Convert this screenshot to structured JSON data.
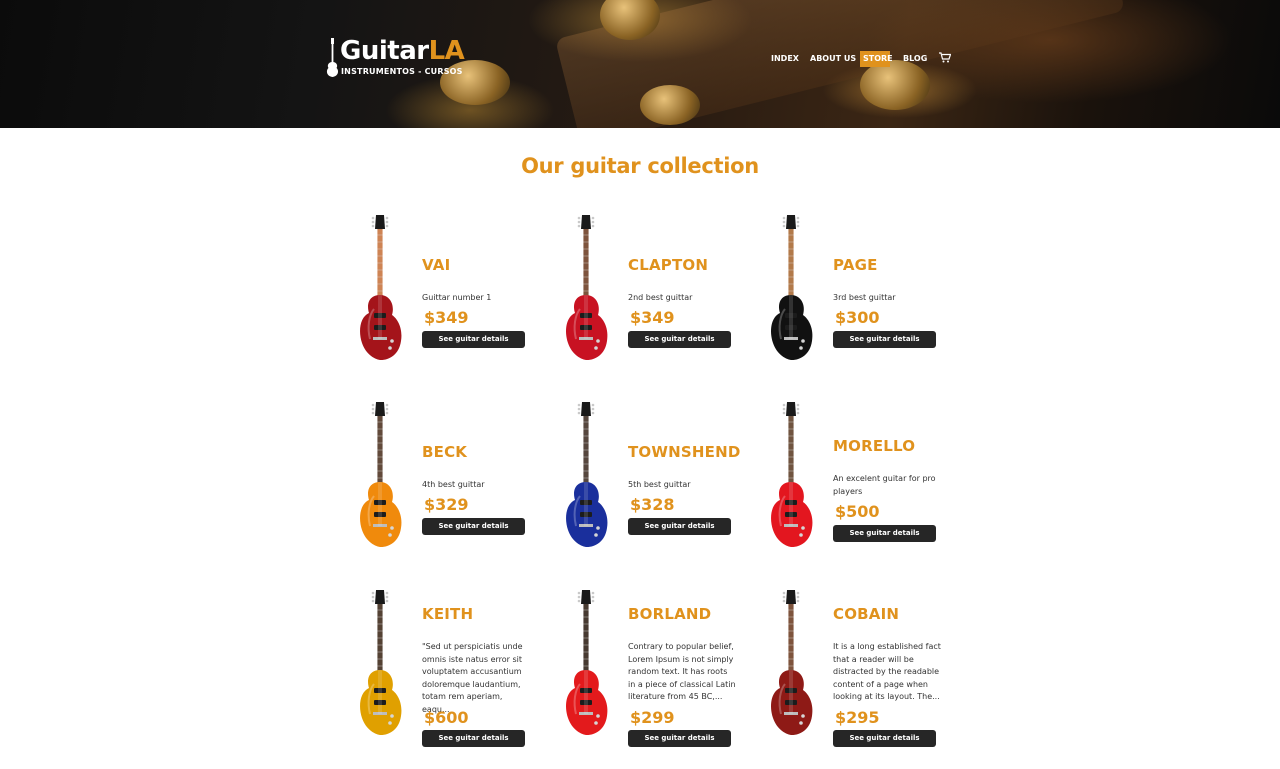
{
  "header": {
    "logo": {
      "word_main": "Guitar",
      "word_accent": "LA",
      "subtitle": "INSTRUMENTOS - CURSOS"
    },
    "nav": [
      {
        "label": "INDEX",
        "active": false
      },
      {
        "label": "ABOUT US",
        "active": false
      },
      {
        "label": "STORE",
        "active": true
      },
      {
        "label": "BLOG",
        "active": false
      }
    ],
    "cart_icon": "shopping-cart-icon"
  },
  "main": {
    "title": "Our guitar collection",
    "button_label": "See guitar details",
    "guitars": [
      {
        "name": "VAI",
        "description": "Guittar number 1",
        "price": "$349",
        "body_color": "#a4141a",
        "neck_color": "#c9713a"
      },
      {
        "name": "CLAPTON",
        "description": "2nd best guittar",
        "price": "$349",
        "body_color": "#c81222",
        "neck_color": "#6b3a1e"
      },
      {
        "name": "PAGE",
        "description": "3rd best guittar",
        "price": "$300",
        "body_color": "#111111",
        "neck_color": "#a8652e"
      },
      {
        "name": "BECK",
        "description": "4th best guittar",
        "price": "$329",
        "body_color": "#f08a0c",
        "neck_color": "#4a2e1c"
      },
      {
        "name": "TOWNSHEND",
        "description": "5th best guittar",
        "price": "$328",
        "body_color": "#1a2f9c",
        "neck_color": "#3b2a20"
      },
      {
        "name": "MORELLO",
        "description": "An excelent guitar for pro players",
        "price": "$500",
        "body_color": "#e3161f",
        "neck_color": "#5a3a22"
      },
      {
        "name": "KEITH",
        "description": "\"Sed ut perspiciatis unde omnis iste natus error sit voluptatem accusantium doloremque laudantium, totam rem aperiam, eaqu...",
        "price": "$600",
        "body_color": "#e0a000",
        "neck_color": "#3a2414"
      },
      {
        "name": "BORLAND",
        "description": "Contrary to popular belief, Lorem Ipsum is not simply random text. It has roots in a piece of classical Latin literature from 45 BC,...",
        "price": "$299",
        "body_color": "#e31a1c",
        "neck_color": "#2a1a10"
      },
      {
        "name": "COBAIN",
        "description": "It is a long established fact that a reader will be distracted by the readable content of a page when looking at its layout. The...",
        "price": "$295",
        "body_color": "#8e1a16",
        "neck_color": "#6b3a1e"
      }
    ]
  }
}
